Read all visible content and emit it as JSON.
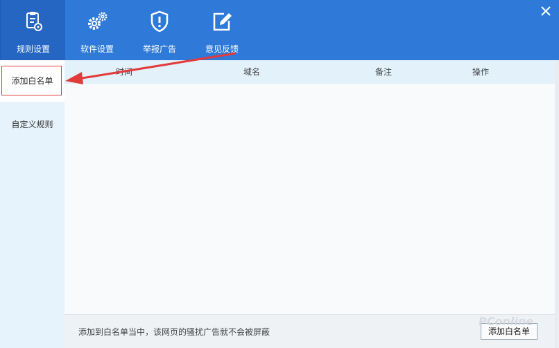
{
  "header": {
    "tabs": [
      {
        "label": "规则设置",
        "icon": "clipboard-gear-icon",
        "active": true
      },
      {
        "label": "软件设置",
        "icon": "gears-icon",
        "active": false
      },
      {
        "label": "举报广告",
        "icon": "shield-alert-icon",
        "active": false
      },
      {
        "label": "意见反馈",
        "icon": "edit-icon",
        "active": false
      }
    ],
    "close_icon": "close-icon"
  },
  "sidebar": {
    "items": [
      {
        "label": "添加白名单",
        "active": true
      },
      {
        "label": "自定义规则",
        "active": false
      }
    ]
  },
  "table": {
    "columns": [
      "时间",
      "域名",
      "备注",
      "操作"
    ],
    "rows": []
  },
  "footer": {
    "hint": "添加到白名单当中，该网页的骚扰广告就不会被屏蔽",
    "add_button_label": "添加白名单"
  },
  "watermark": {
    "text": "PConline"
  },
  "colors": {
    "header": "#2f7ad8",
    "active_tab": "#2566c2",
    "sidebar": "#e6f3fc",
    "annotation": "#e23b3b"
  }
}
